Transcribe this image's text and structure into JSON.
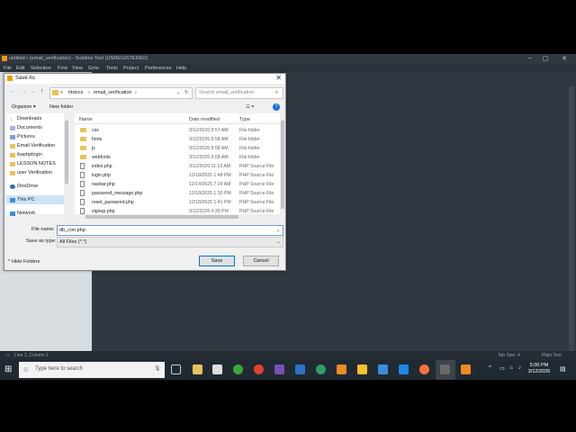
{
  "sublime": {
    "title": "untitled • (email_verification) - Sublime Text (UNREGISTERED)",
    "menu": [
      "File",
      "Edit",
      "Selection",
      "Find",
      "View",
      "Goto",
      "Tools",
      "Project",
      "Preferences",
      "Help"
    ],
    "status_left": "Line 1, Column 1",
    "status_tab": "Tab Size: 4",
    "status_syntax": "Plain Text"
  },
  "dialog": {
    "title": "Save As",
    "breadcrumbs": [
      "«",
      "htdocs",
      "›",
      "email_verification",
      "›"
    ],
    "search_placeholder": "Search email_verification",
    "organize": "Organize ▾",
    "new_folder": "New folder",
    "nav_items": [
      "Downloads",
      "Documents",
      "Pictures",
      "Email Verification",
      "ikephplogin",
      "LESSON NOTES",
      "user Verification",
      "OneDrive",
      "This PC",
      "Network"
    ],
    "columns": {
      "name": "Name",
      "date": "Date modified",
      "type": "Type"
    },
    "files": [
      {
        "name": "css",
        "date": "3/12/2026 9:57 AM",
        "type": "File folder",
        "kind": "folder"
      },
      {
        "name": "fonts",
        "date": "3/12/2026 9:58 AM",
        "type": "File folder",
        "kind": "folder"
      },
      {
        "name": "js",
        "date": "3/12/2026 9:58 AM",
        "type": "File folder",
        "kind": "folder"
      },
      {
        "name": "webfonts",
        "date": "3/12/2026 9:58 AM",
        "type": "File folder",
        "kind": "folder"
      },
      {
        "name": "index.php",
        "date": "3/12/2026 11:13 AM",
        "type": "PHP Source File",
        "kind": "file"
      },
      {
        "name": "login.php",
        "date": "12/18/2025 1:48 PM",
        "type": "PHP Source File",
        "kind": "file"
      },
      {
        "name": "navbar.php",
        "date": "12/14/2025 7:24 AM",
        "type": "PHP Source File",
        "kind": "file"
      },
      {
        "name": "password_message.php",
        "date": "12/18/2025 1:30 PM",
        "type": "PHP Source File",
        "kind": "file"
      },
      {
        "name": "reset_password.php",
        "date": "12/18/2025 1:41 PM",
        "type": "PHP Source File",
        "kind": "file"
      },
      {
        "name": "signup.php",
        "date": "3/12/2026 4:39 PM",
        "type": "PHP Source File",
        "kind": "file"
      }
    ],
    "file_name_label": "File name:",
    "file_name_value": "db_con.php",
    "save_as_type_label": "Save as type:",
    "save_as_type_value": "All Files (*.*)",
    "save": "Save",
    "cancel": "Cancel",
    "hide_folders": "Hide Folders"
  },
  "taskbar": {
    "search_placeholder": "Type here to search",
    "time": "5:00 PM",
    "date": "3/12/2026"
  },
  "colors": {
    "sublime_bg": "#303841",
    "accent": "#0078d7",
    "taskbar": "#202a33"
  }
}
